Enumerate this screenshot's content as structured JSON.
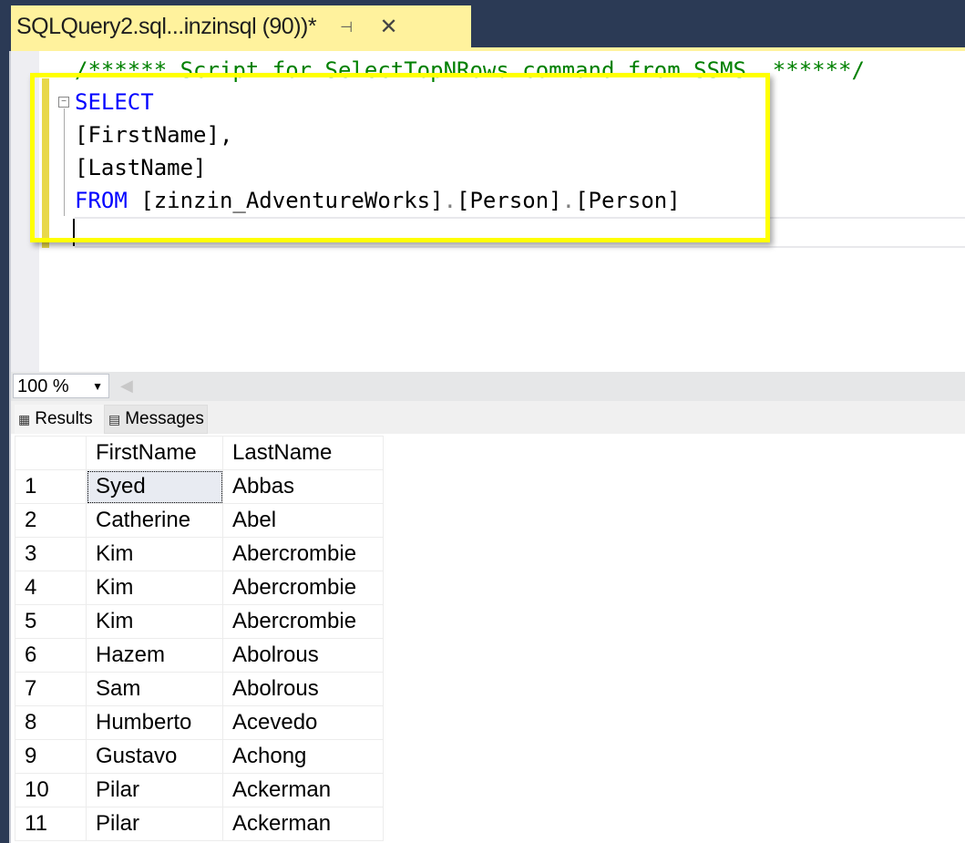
{
  "tab": {
    "title": "SQLQuery2.sql...inzinsql (90))*",
    "pin_icon": "pin-icon",
    "close_icon": "close-icon"
  },
  "editor": {
    "comment": "/****** Script for SelectTopNRows command from SSMS  ******/",
    "lines": [
      {
        "kw": "SELECT",
        "rest": ""
      },
      {
        "kw": "",
        "rest": "[FirstName],"
      },
      {
        "kw": "",
        "rest": "[LastName]"
      },
      {
        "kw": "FROM",
        "rest": " [zinzin_AdventureWorks]",
        "dot1": ".",
        "p2": "[Person]",
        "dot2": ".",
        "p3": "[Person]"
      }
    ],
    "highlight_color": "#ffff00"
  },
  "zoom": {
    "value": "100 %"
  },
  "result_tabs": [
    {
      "label": "Results",
      "icon": "grid-icon"
    },
    {
      "label": "Messages",
      "icon": "messages-icon"
    }
  ],
  "results": {
    "columns": [
      "",
      "FirstName",
      "LastName"
    ],
    "rows": [
      [
        "1",
        "Syed",
        "Abbas"
      ],
      [
        "2",
        "Catherine",
        "Abel"
      ],
      [
        "3",
        "Kim",
        "Abercrombie"
      ],
      [
        "4",
        "Kim",
        "Abercrombie"
      ],
      [
        "5",
        "Kim",
        "Abercrombie"
      ],
      [
        "6",
        "Hazem",
        "Abolrous"
      ],
      [
        "7",
        "Sam",
        "Abolrous"
      ],
      [
        "8",
        "Humberto",
        "Acevedo"
      ],
      [
        "9",
        "Gustavo",
        "Achong"
      ],
      [
        "10",
        "Pilar",
        "Ackerman"
      ],
      [
        "11",
        "Pilar",
        "Ackerman"
      ]
    ]
  }
}
